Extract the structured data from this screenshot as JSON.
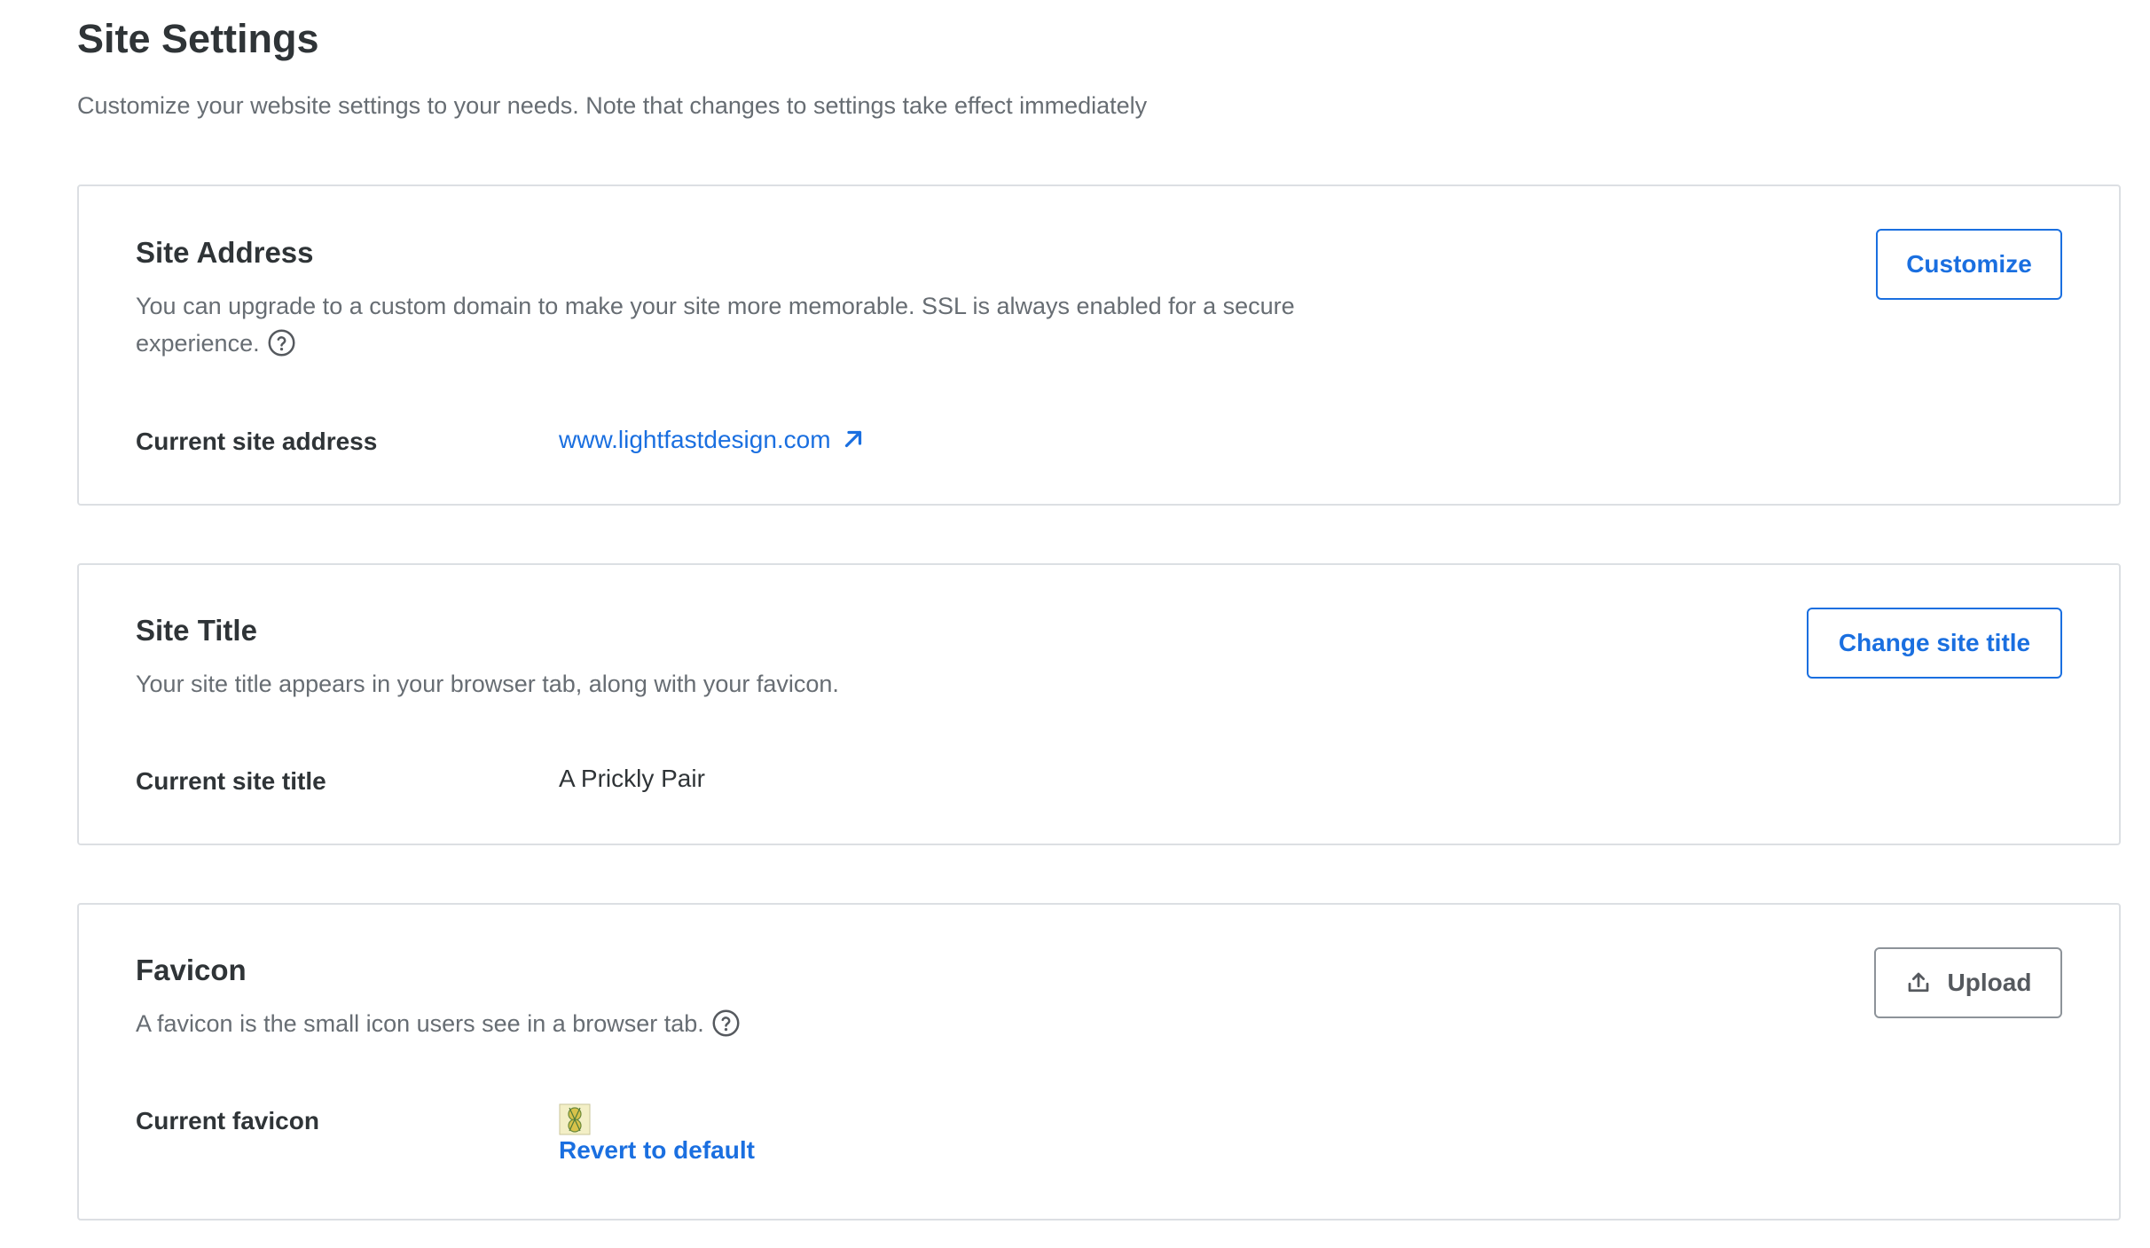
{
  "page": {
    "title": "Site Settings",
    "subtitle": "Customize your website settings to your needs. Note that changes to settings take effect immediately"
  },
  "site_address": {
    "title": "Site Address",
    "description": "You can upgrade to a custom domain to make your site more memorable. SSL is always enabled for a secure experience.",
    "help_icon": "question-circle-icon",
    "label": "Current site address",
    "value": "www.lightfastdesign.com",
    "value_icon": "arrow-up-right-icon",
    "button_label": "Customize"
  },
  "site_title": {
    "title": "Site Title",
    "description": "Your site title appears in your browser tab, along with your favicon.",
    "label": "Current site title",
    "value": "A Prickly Pair",
    "button_label": "Change site title"
  },
  "favicon": {
    "title": "Favicon",
    "description": "A favicon is the small icon users see in a browser tab.",
    "help_icon": "question-circle-icon",
    "label": "Current favicon",
    "revert_label": "Revert to default",
    "button_label": "Upload",
    "button_icon": "upload-icon"
  },
  "colors": {
    "accent": "#1a6fe0",
    "text_primary": "#2f3437",
    "text_secondary": "#676d73",
    "border": "#dcdfe3"
  }
}
